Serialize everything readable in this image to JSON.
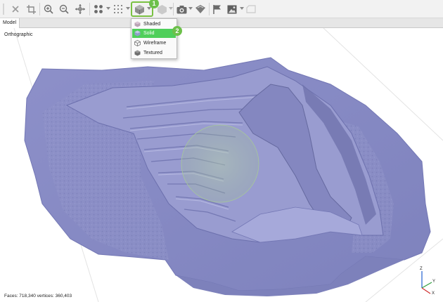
{
  "viewport": {
    "projection": "Orthographic",
    "status": "Faces: 718,340 vertices: 360,403",
    "axis_labels": {
      "z": "Z",
      "y": "Y",
      "x": "X"
    }
  },
  "tabs": [
    {
      "label": "Model"
    }
  ],
  "render_menu": {
    "items": [
      {
        "label": "Shaded",
        "icon": "shaded-cube-icon"
      },
      {
        "label": "Solid",
        "icon": "solid-cube-icon",
        "selected": true
      },
      {
        "label": "Wireframe",
        "icon": "wireframe-cube-icon"
      },
      {
        "label": "Textured",
        "icon": "textured-cube-icon"
      }
    ]
  },
  "callouts": {
    "step1": "1",
    "step2": "2"
  },
  "toolbar_icons": [
    "close-icon",
    "crop-icon",
    "zoom-in-icon",
    "zoom-out-icon",
    "move-icon",
    "point-grid-icon",
    "dot-grid-icon",
    "render-mode-icon",
    "lighting-icon",
    "camera-icon",
    "measure-icon",
    "flag-icon",
    "image-icon",
    "box-icon"
  ],
  "colors": {
    "mesh": "#8a8ec7",
    "highlight": "#7ac143",
    "menu_selected": "#4fcf5b"
  }
}
